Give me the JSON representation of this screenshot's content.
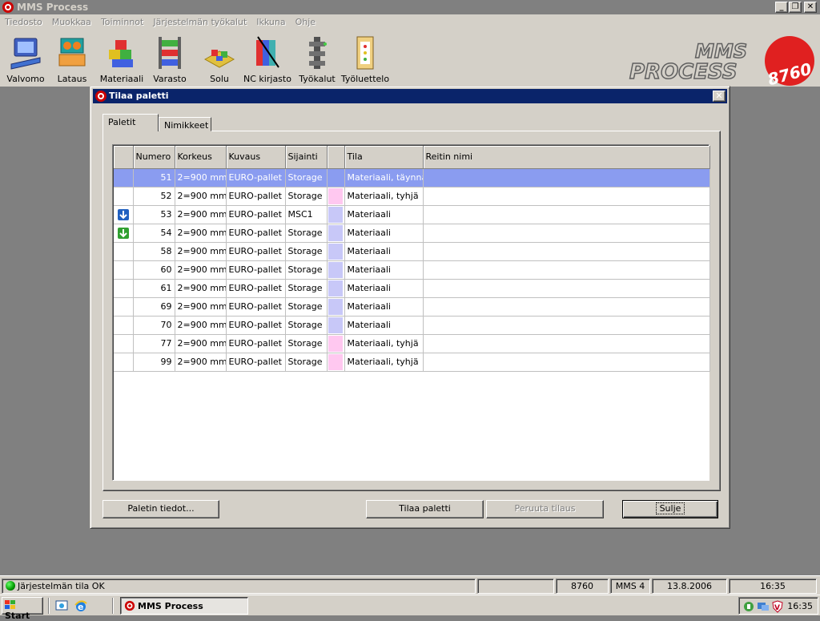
{
  "window": {
    "title": "MMS Process"
  },
  "menu": [
    "Tiedosto",
    "Muokkaa",
    "Toiminnot",
    "Järjestelmän työkalut",
    "Ikkuna",
    "Ohje"
  ],
  "toolbar": [
    {
      "label": "Valvomo",
      "icon": "monitor-icon"
    },
    {
      "label": "Lataus",
      "icon": "loading-station-icon"
    },
    {
      "label": "Materiaali",
      "icon": "material-blocks-icon"
    },
    {
      "label": "Varasto",
      "icon": "storage-rack-icon"
    },
    {
      "label": "Solu",
      "icon": "cell-icon"
    },
    {
      "label": "NC kirjasto",
      "icon": "nc-library-icon"
    },
    {
      "label": "Työkalut",
      "icon": "tools-icon"
    },
    {
      "label": "Työluettelo",
      "icon": "work-list-icon"
    }
  ],
  "logo": {
    "text": "MMS PROCESS",
    "badge": "8760"
  },
  "dialog": {
    "title": "Tilaa paletti",
    "tabs": [
      "Paletit",
      "Nimikkeet"
    ],
    "columns": [
      "",
      "Numero",
      "Korkeus",
      "Kuvaus",
      "Sijainti",
      "",
      "Tila",
      "Reitin nimi"
    ],
    "rows": [
      {
        "icon": "",
        "numero": "51",
        "korkeus": "2=900 mm",
        "kuvaus": "EURO-pallet",
        "sijainti": "Storage",
        "color": "",
        "tila": "Materiaali, täynnä",
        "reitti": "",
        "selected": true
      },
      {
        "icon": "",
        "numero": "52",
        "korkeus": "2=900 mm",
        "kuvaus": "EURO-pallet",
        "sijainti": "Storage",
        "color": "#ffc8f0",
        "tila": "Materiaali, tyhjä",
        "reitti": ""
      },
      {
        "icon": "blue-down-arrow-icon",
        "numero": "53",
        "korkeus": "2=900 mm",
        "kuvaus": "EURO-pallet",
        "sijainti": "MSC1",
        "color": "#c8c8f8",
        "tila": "Materiaali",
        "reitti": ""
      },
      {
        "icon": "green-down-arrow-icon",
        "numero": "54",
        "korkeus": "2=900 mm",
        "kuvaus": "EURO-pallet",
        "sijainti": "Storage",
        "color": "#c8c8f8",
        "tila": "Materiaali",
        "reitti": ""
      },
      {
        "icon": "",
        "numero": "58",
        "korkeus": "2=900 mm",
        "kuvaus": "EURO-pallet",
        "sijainti": "Storage",
        "color": "#c8c8f8",
        "tila": "Materiaali",
        "reitti": ""
      },
      {
        "icon": "",
        "numero": "60",
        "korkeus": "2=900 mm",
        "kuvaus": "EURO-pallet",
        "sijainti": "Storage",
        "color": "#c8c8f8",
        "tila": "Materiaali",
        "reitti": ""
      },
      {
        "icon": "",
        "numero": "61",
        "korkeus": "2=900 mm",
        "kuvaus": "EURO-pallet",
        "sijainti": "Storage",
        "color": "#c8c8f8",
        "tila": "Materiaali",
        "reitti": ""
      },
      {
        "icon": "",
        "numero": "69",
        "korkeus": "2=900 mm",
        "kuvaus": "EURO-pallet",
        "sijainti": "Storage",
        "color": "#c8c8f8",
        "tila": "Materiaali",
        "reitti": ""
      },
      {
        "icon": "",
        "numero": "70",
        "korkeus": "2=900 mm",
        "kuvaus": "EURO-pallet",
        "sijainti": "Storage",
        "color": "#c8c8f8",
        "tila": "Materiaali",
        "reitti": ""
      },
      {
        "icon": "",
        "numero": "77",
        "korkeus": "2=900 mm",
        "kuvaus": "EURO-pallet",
        "sijainti": "Storage",
        "color": "#ffc8f0",
        "tila": "Materiaali, tyhjä",
        "reitti": ""
      },
      {
        "icon": "",
        "numero": "99",
        "korkeus": "2=900 mm",
        "kuvaus": "EURO-pallet",
        "sijainti": "Storage",
        "color": "#ffc8f0",
        "tila": "Materiaali, tyhjä",
        "reitti": ""
      }
    ],
    "buttons": {
      "details": "Paletin tiedot...",
      "order": "Tilaa paletti",
      "cancel_order": "Peruuta tilaus",
      "close": "Sulje"
    }
  },
  "statusbar": {
    "status": "Järjestelmän tila OK",
    "code": "8760",
    "mms": "MMS 4",
    "date": "13.8.2006",
    "time": "16:35"
  },
  "taskbar": {
    "start": "Start",
    "task": "MMS Process",
    "clock": "16:35"
  }
}
